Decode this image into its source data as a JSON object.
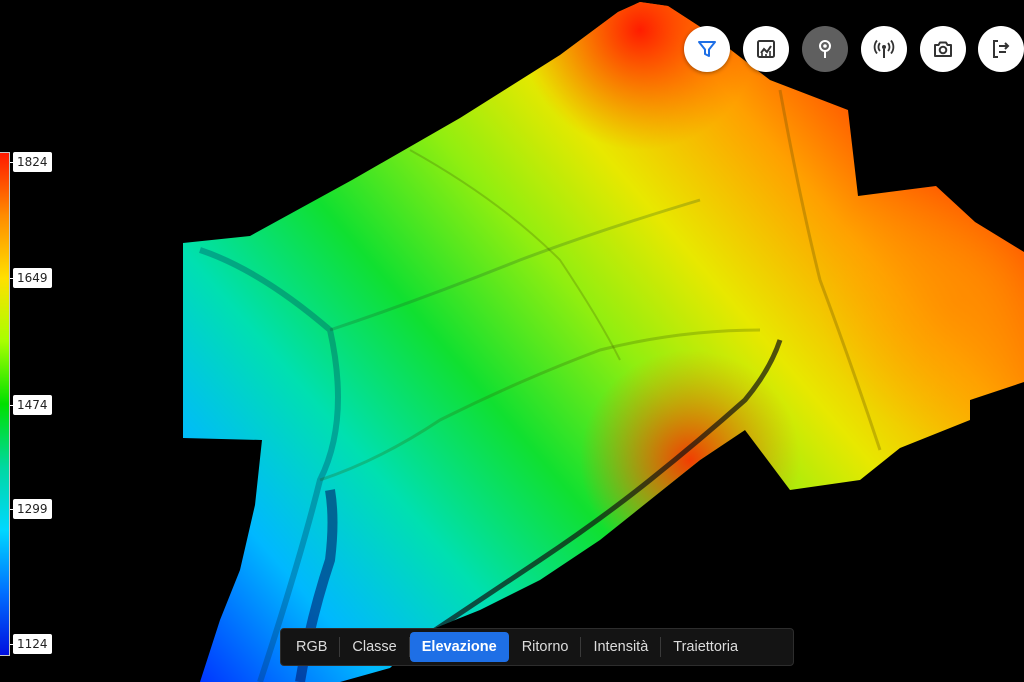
{
  "legend": {
    "labels": [
      "1824",
      "1649",
      "1474",
      "1299",
      "1124"
    ],
    "gradient_colors": [
      "#ff1a00",
      "#ff8c00",
      "#ffe000",
      "#a8ff00",
      "#00e000",
      "#00d8a0",
      "#00d8ff",
      "#0070ff",
      "#0010e0"
    ]
  },
  "toolbar": {
    "buttons": [
      {
        "icon": "filter-icon",
        "active": false
      },
      {
        "icon": "chart-icon",
        "active": false
      },
      {
        "icon": "location-pin-icon",
        "active": true
      },
      {
        "icon": "antenna-icon",
        "active": false
      },
      {
        "icon": "camera-icon",
        "active": false
      },
      {
        "icon": "exit-icon",
        "active": false
      }
    ],
    "icon_color": "#1e6fe6"
  },
  "tabs": {
    "items": [
      {
        "label": "RGB"
      },
      {
        "label": "Classe"
      },
      {
        "label": "Elevazione"
      },
      {
        "label": "Ritorno"
      },
      {
        "label": "Intensità"
      },
      {
        "label": "Traiettoria"
      }
    ],
    "active_index": 2,
    "accent_color": "#1e6fe6"
  }
}
